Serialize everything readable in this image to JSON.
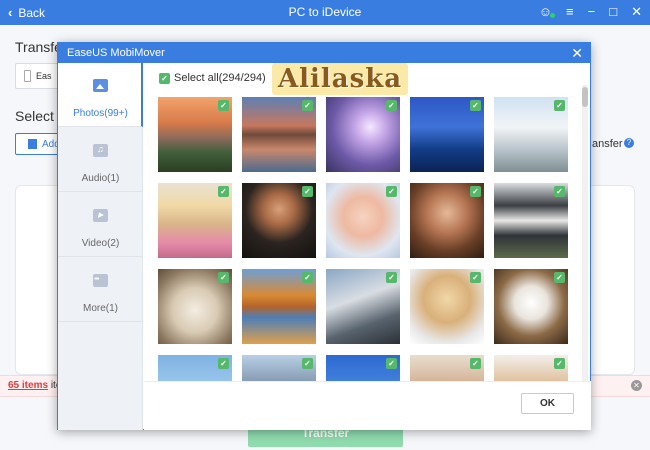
{
  "app": {
    "back_label": "Back",
    "title": "PC to iDevice",
    "icons": [
      "user-icon",
      "menu-icon",
      "minimize-icon",
      "maximize-icon",
      "close-icon"
    ]
  },
  "background": {
    "heading": "Transfer to iDevice",
    "device_label": "Eas",
    "select_heading": "Select it",
    "add_label": "Add",
    "transfer_text": "ansfer",
    "items_count": "65 items",
    "items_suffix": "ite",
    "transfer_button": "Transfer"
  },
  "dialog": {
    "title": "EaseUS MobiMover",
    "select_all": "Select all(294/294)",
    "ok_label": "OK",
    "watermark": "Alilaska",
    "sidebar": [
      {
        "label": "Photos(99+)",
        "icon": "photo-icon",
        "active": true
      },
      {
        "label": "Audio(1)",
        "icon": "music-icon",
        "active": false
      },
      {
        "label": "Video(2)",
        "icon": "video-icon",
        "active": false
      },
      {
        "label": "More(1)",
        "icon": "more-icon",
        "active": false
      }
    ],
    "photos": [
      {
        "desc": "sunset-lake",
        "checked": true
      },
      {
        "desc": "mountain-reflection",
        "checked": true
      },
      {
        "desc": "purple-sky",
        "checked": true
      },
      {
        "desc": "blue-skyscrapers",
        "checked": true
      },
      {
        "desc": "curved-building",
        "checked": true
      },
      {
        "desc": "blonde-woman",
        "checked": true
      },
      {
        "desc": "man-portrait",
        "checked": true
      },
      {
        "desc": "surprised-baby",
        "checked": true
      },
      {
        "desc": "woman-portrait",
        "checked": true
      },
      {
        "desc": "village-rooftops",
        "checked": true
      },
      {
        "desc": "puppy-on-back",
        "checked": true
      },
      {
        "desc": "autumn-mountain-lake",
        "checked": true
      },
      {
        "desc": "modern-building",
        "checked": true
      },
      {
        "desc": "golden-puppy",
        "checked": true
      },
      {
        "desc": "puppies-in-basket",
        "checked": true
      },
      {
        "desc": "beach-sky",
        "checked": true
      },
      {
        "desc": "rocky-landscape",
        "checked": true
      },
      {
        "desc": "blue-sky",
        "checked": true
      },
      {
        "desc": "cat",
        "checked": true
      },
      {
        "desc": "dog",
        "checked": true
      }
    ],
    "theme": {
      "accent": "#3a7de0",
      "check_green": "#55b86a",
      "transfer_green": "#8fdcae",
      "alert_red": "#e03c3c"
    }
  }
}
